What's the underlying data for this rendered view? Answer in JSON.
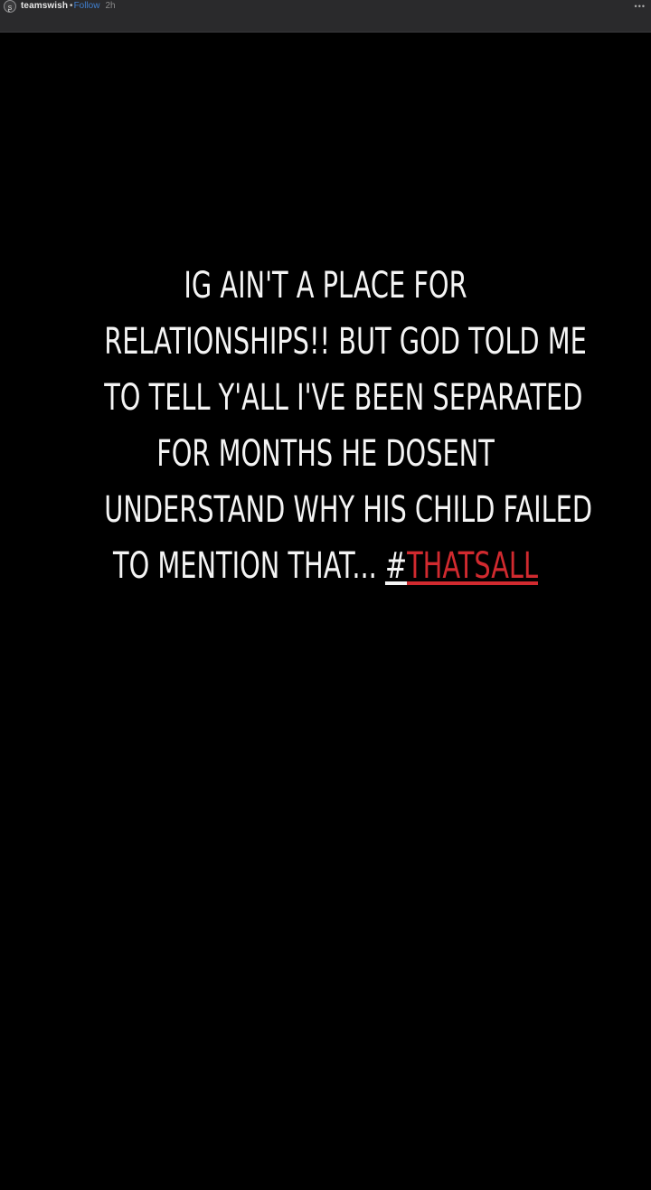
{
  "header": {
    "avatar_icon": "avatar-icon",
    "username": "teamswish",
    "separator": "•",
    "follow_label": "Follow",
    "time": "2h",
    "more_label": "•••"
  },
  "story": {
    "lines": [
      "IG AIN'T A PLACE FOR",
      "RELATIONSHIPS!! BUT GOD TOLD ME",
      "TO TELL Y'ALL I'VE BEEN SEPARATED",
      "FOR MONTHS HE DOSENT",
      "UNDERSTAND WHY HIS CHILD FAILED"
    ],
    "last_line_text": "TO MENTION THAT... ",
    "hashtag_symbol": "#",
    "hashtag_word": "THATSALL",
    "text_color": "#f4f4f4",
    "hashtag_color": "#d12a2f"
  }
}
